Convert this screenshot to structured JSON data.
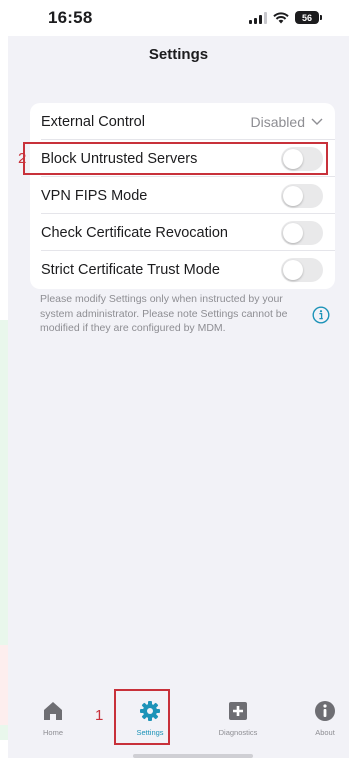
{
  "status_bar": {
    "time": "16:58",
    "battery": "56"
  },
  "header": {
    "title": "Settings"
  },
  "settings": {
    "external_control": {
      "label": "External Control",
      "value": "Disabled"
    },
    "toggles": [
      {
        "label": "Block Untrusted Servers",
        "on": false
      },
      {
        "label": "VPN FIPS Mode",
        "on": false
      },
      {
        "label": "Check Certificate Revocation",
        "on": false
      },
      {
        "label": "Strict Certificate Trust Mode",
        "on": false
      }
    ]
  },
  "help_text": "Please modify Settings only when instructed by your system administrator. Please note Settings cannot be modified if they are configured by MDM.",
  "annotations": {
    "step1": "1",
    "step2": "2"
  },
  "tabs": [
    {
      "label": "Home",
      "icon": "home-icon"
    },
    {
      "label": "Settings",
      "icon": "gear-icon",
      "active": true
    },
    {
      "label": "Diagnostics",
      "icon": "plus-square-icon"
    },
    {
      "label": "About",
      "icon": "info-circle-icon"
    }
  ],
  "colors": {
    "accent": "#1d93b8",
    "highlight": "#c8313a"
  }
}
